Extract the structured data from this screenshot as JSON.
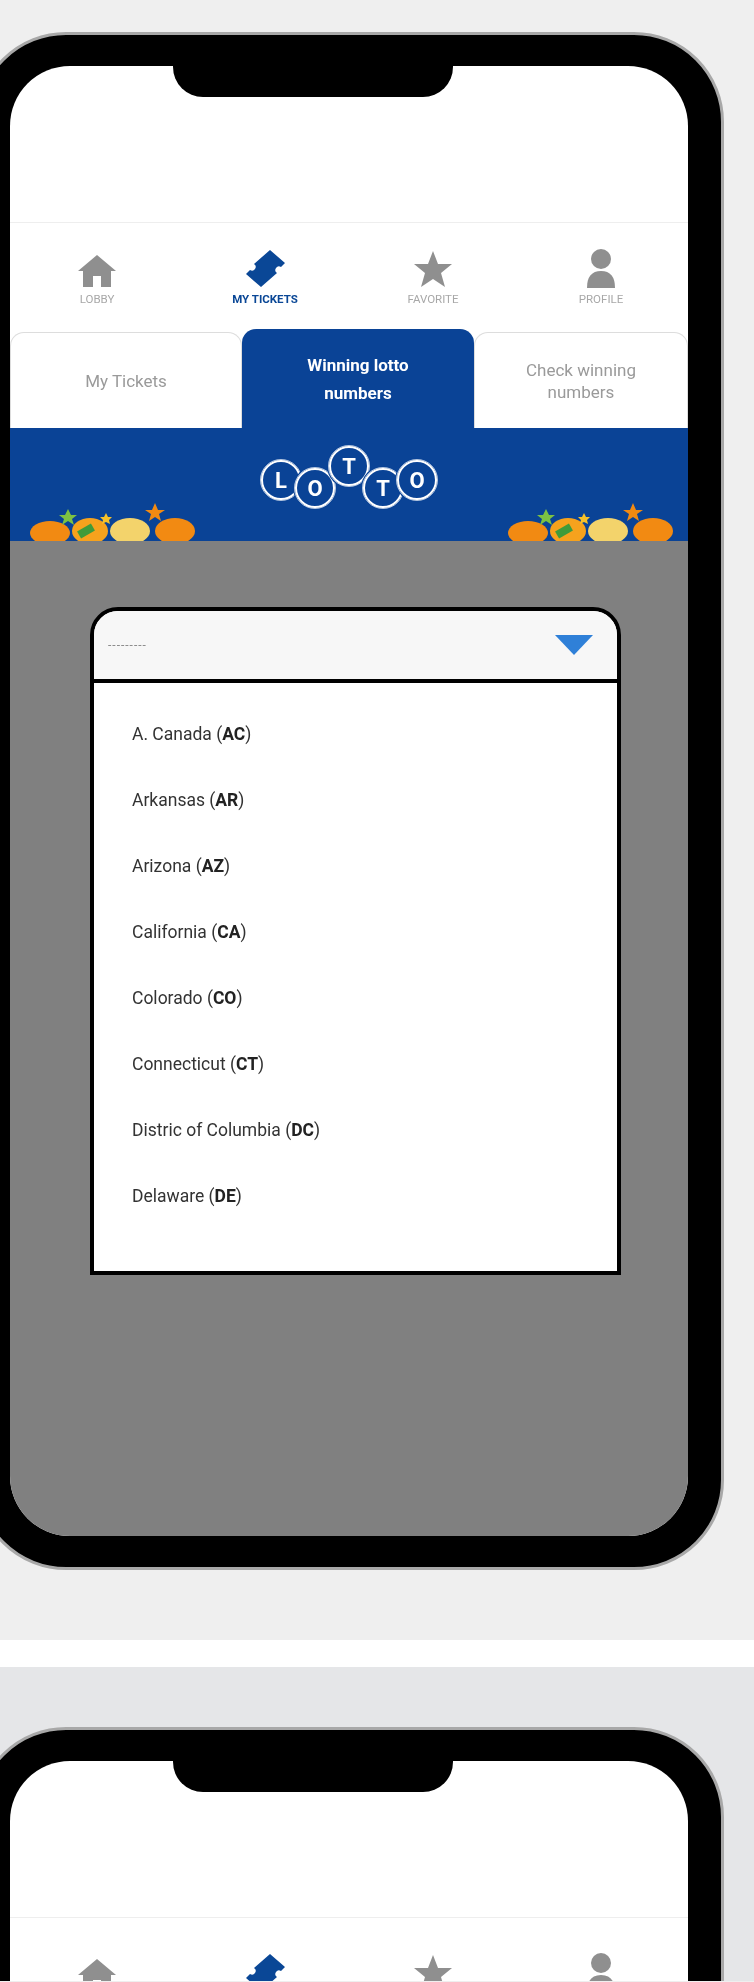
{
  "phones": [
    {
      "nav": [
        {
          "label": "LOBBY",
          "selected": false
        },
        {
          "label": "MY TICKETS",
          "selected": true
        },
        {
          "label": "FAVORITE",
          "selected": false
        },
        {
          "label": "PROFILE",
          "selected": false
        }
      ],
      "tabs": [
        {
          "label": "My Tickets",
          "selected": false
        },
        {
          "label": "Winning lotto numbers",
          "selected": true
        },
        {
          "label": "Check winning numbers",
          "selected": false
        }
      ],
      "dropdown": {
        "placeholder": "---------",
        "expanded": true,
        "options": [
          "A. Canada (**AC**)",
          "Arkansas (**AR**)",
          "Arizona (**AZ**)",
          "California (**CA**)",
          "Colorado (**CO**)",
          "Connecticut (**CT**)",
          "Distric of Columbia (**DC**)",
          "Delaware (**DE**)"
        ]
      },
      "logo_letters": [
        "L",
        "O",
        "T",
        "T",
        "O"
      ]
    },
    {
      "nav": [
        {
          "selected": false
        },
        {
          "selected": true
        },
        {
          "selected": false
        },
        {
          "selected": false
        }
      ]
    }
  ]
}
